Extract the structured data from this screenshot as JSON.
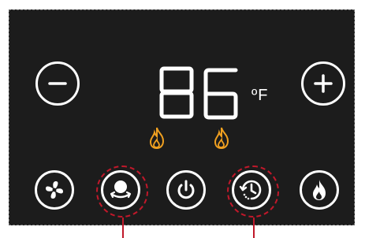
{
  "display": {
    "temperature": "86",
    "unit": "ºF"
  },
  "icons": {
    "minus": "minus-icon",
    "plus": "plus-icon",
    "fan": "fan-icon",
    "swing": "swing-icon",
    "power": "power-icon",
    "timer": "timer-icon",
    "heat": "flame-icon",
    "indicator": "flame-outline-icon"
  },
  "colors": {
    "panel": "#1c1c1c",
    "foreground": "#ffffff",
    "indicator": "#f0a020",
    "highlight": "#c0182a"
  }
}
